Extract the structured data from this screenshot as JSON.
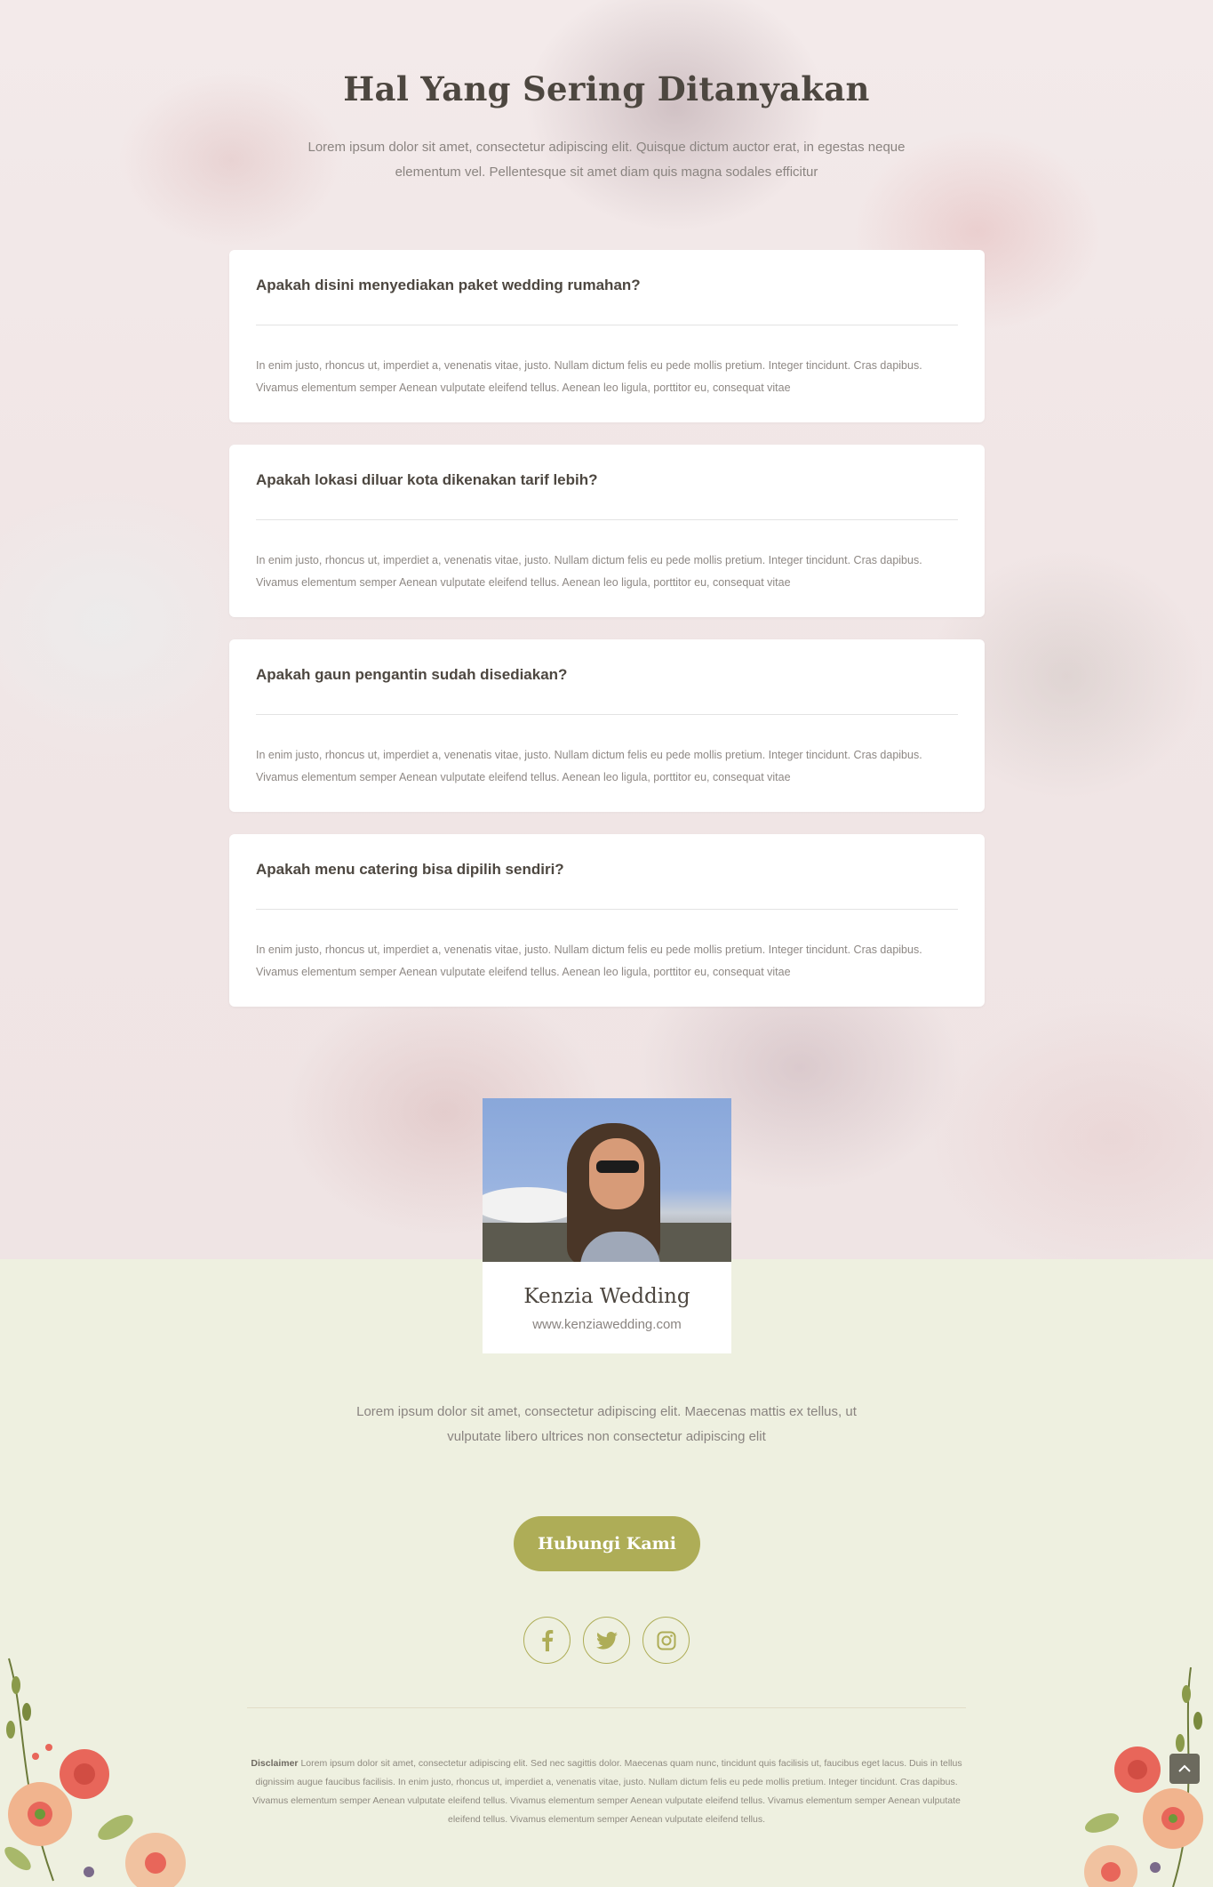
{
  "faq": {
    "title": "Hal Yang Sering Ditanyakan",
    "intro": "Lorem ipsum dolor sit amet, consectetur adipiscing elit. Quisque dictum auctor erat, in egestas neque elementum vel. Pellentesque sit amet diam quis magna sodales efficitur",
    "items": [
      {
        "question": "Apakah disini menyediakan paket wedding rumahan?",
        "answer": "In enim justo, rhoncus ut, imperdiet a, venenatis vitae, justo. Nullam dictum felis eu pede mollis pretium. Integer tincidunt. Cras dapibus. Vivamus elementum semper Aenean vulputate eleifend tellus. Aenean leo ligula, porttitor eu, consequat vitae"
      },
      {
        "question": "Apakah lokasi diluar kota dikenakan tarif lebih?",
        "answer": "In enim justo, rhoncus ut, imperdiet a, venenatis vitae, justo. Nullam dictum felis eu pede mollis pretium. Integer tincidunt. Cras dapibus. Vivamus elementum semper Aenean vulputate eleifend tellus. Aenean leo ligula, porttitor eu, consequat vitae"
      },
      {
        "question": "Apakah gaun pengantin sudah disediakan?",
        "answer": "In enim justo, rhoncus ut, imperdiet a, venenatis vitae, justo. Nullam dictum felis eu pede mollis pretium. Integer tincidunt. Cras dapibus. Vivamus elementum semper Aenean vulputate eleifend tellus. Aenean leo ligula, porttitor eu, consequat vitae"
      },
      {
        "question": "Apakah menu catering bisa dipilih sendiri?",
        "answer": "In enim justo, rhoncus ut, imperdiet a, venenatis vitae, justo. Nullam dictum felis eu pede mollis pretium. Integer tincidunt. Cras dapibus. Vivamus elementum semper Aenean vulputate eleifend tellus. Aenean leo ligula, porttitor eu, consequat vitae"
      }
    ]
  },
  "profile": {
    "name": "Kenzia Wedding",
    "url": "www.kenziawedding.com"
  },
  "footer": {
    "text": "Lorem ipsum dolor sit amet, consectetur adipiscing elit. Maecenas mattis ex tellus, ut vulputate libero ultrices non consectetur adipiscing elit",
    "cta_label": "Hubungi Kami",
    "socials": [
      "facebook-icon",
      "twitter-icon",
      "instagram-icon"
    ],
    "disclaimer_label": "Disclaimer",
    "disclaimer_text": "Lorem ipsum dolor sit amet, consectetur adipiscing elit. Sed nec sagittis dolor. Maecenas quam nunc, tincidunt quis facilisis ut, faucibus eget lacus. Duis in tellus dignissim augue faucibus facilisis. In enim justo, rhoncus ut, imperdiet a, venenatis vitae, justo. Nullam dictum felis eu pede mollis pretium. Integer tincidunt. Cras dapibus. Vivamus elementum semper Aenean vulputate eleifend tellus. Vivamus elementum semper Aenean vulputate eleifend tellus. Vivamus elementum semper Aenean vulputate eleifend tellus. Vivamus elementum semper Aenean vulputate eleifend tellus."
  },
  "colors": {
    "accent": "#aead57",
    "heading": "#4d4740",
    "footer_bg": "#eef0e0"
  }
}
